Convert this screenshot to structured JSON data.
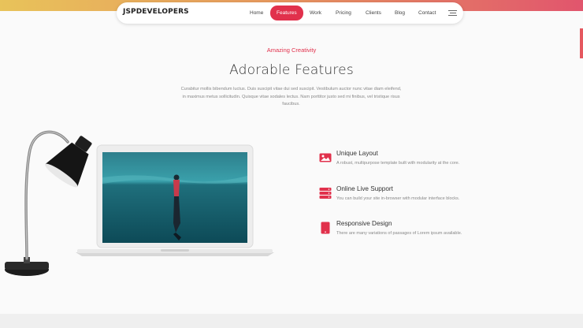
{
  "brand": {
    "name": "JSPDEVELOPERS"
  },
  "nav": {
    "items": [
      {
        "label": "Home"
      },
      {
        "label": "Features"
      },
      {
        "label": "Work"
      },
      {
        "label": "Pricing"
      },
      {
        "label": "Clients"
      },
      {
        "label": "Blog"
      },
      {
        "label": "Contact"
      }
    ],
    "active": "Features",
    "menu_icon": "hamburger-menu-icon"
  },
  "section": {
    "eyebrow": "Amazing Creativity",
    "title": "Adorable Features",
    "intro": "Curabitur mollis bibendum luctus. Duis suscipit vitae dui sed suscipit. Vestibulum auctor nunc vitae diam eleifend, in maximus metus sollicitudin. Quisque vitae sodales lectus. Nam porttitor justo sed mi finibus, vel tristique risus faucibus."
  },
  "features": [
    {
      "icon": "image-icon",
      "title": "Unique Layout",
      "desc": "A robust, multipurpose template built with modularity at the core."
    },
    {
      "icon": "server-icon",
      "title": "Online Live Support",
      "desc": "You can build your site in-browser with modular interface blocks."
    },
    {
      "icon": "tablet-icon",
      "title": "Responsive Design",
      "desc": "There are many variations of passages of Lorem ipsum available."
    }
  ],
  "colors": {
    "accent": "#e1314c",
    "gradient_start": "#e8c35a",
    "gradient_end": "#e1556d"
  }
}
